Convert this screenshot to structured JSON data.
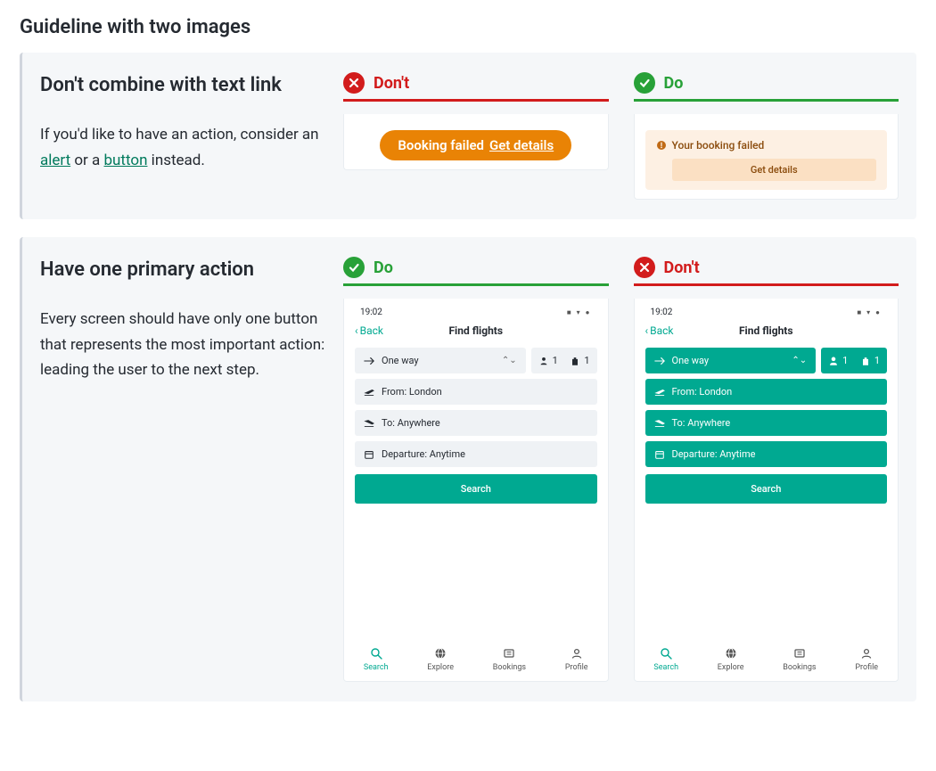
{
  "pageTitle": "Guideline with two images",
  "g1": {
    "heading": "Don't combine with text link",
    "body_pre": "If you'd like to have an action, consider an ",
    "link1": "alert",
    "body_mid": " or a ",
    "link2": "button",
    "body_post": " instead.",
    "dontLabel": "Don't",
    "doLabel": "Do",
    "pillText": "Booking failed",
    "pillLink": "Get details",
    "alertTitle": "Your booking failed",
    "alertBtn": "Get details"
  },
  "g2": {
    "heading": "Have one primary action",
    "body": "Every screen should have only one button that represents the most important action: leading the user to the next step.",
    "doLabel": "Do",
    "dontLabel": "Don't",
    "mobile": {
      "time": "19:02",
      "back": "Back",
      "title": "Find flights",
      "oneway": "One way",
      "pax1": "1",
      "pax2": "1",
      "from": "From: London",
      "to": "To: Anywhere",
      "departure": "Departure: Anytime",
      "search": "Search",
      "nav": {
        "search": "Search",
        "explore": "Explore",
        "bookings": "Bookings",
        "profile": "Profile"
      }
    }
  }
}
